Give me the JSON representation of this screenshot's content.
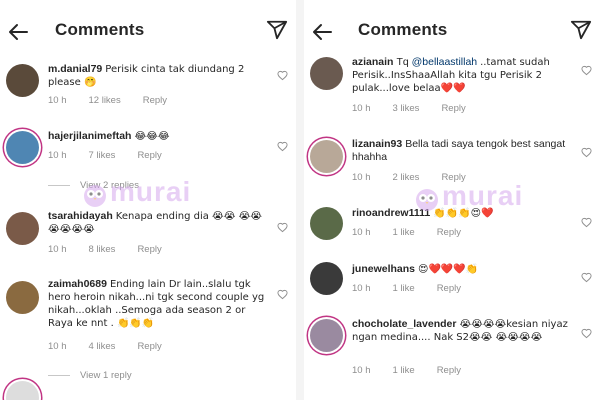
{
  "left": {
    "title": "Comments",
    "comments": [
      {
        "username": "m.danial79",
        "text": "Perisik cinta tak diundang 2 please 🤭",
        "time": "10 h",
        "likes": "12 likes",
        "reply": "Reply",
        "avatar_color": "#5a4a3a"
      },
      {
        "username": "hajerjilanimeftah",
        "text": "😂😂😂",
        "time": "10 h",
        "likes": "7 likes",
        "reply": "Reply",
        "avatar_color": "#4f86b3"
      },
      {
        "username": "tsarahidayah",
        "text": "Kenapa ending dia 😭😭 😭😭😭😭😭😭",
        "time": "10 h",
        "likes": "8 likes",
        "reply": "Reply",
        "avatar_color": "#7a5a48"
      },
      {
        "username": "zaimah0689",
        "text": "Ending lain Dr lain..slalu tgk hero heroin nikah...ni tgk second couple yg nikah...oklah ..Semoga ada season 2 or Raya ke nnt . 👏👏👏",
        "time": "10 h",
        "likes": "4 likes",
        "reply": "Reply",
        "avatar_color": "#8a6a40"
      }
    ],
    "view_replies_1": "View 2 replies",
    "view_replies_2": "View 1 reply"
  },
  "right": {
    "title": "Comments",
    "comments": [
      {
        "username": "azianain",
        "mention": "@bellaastillah",
        "text": "..tamat sudah Perisik..InsShaaAllah kita tgu Perisik  2 pulak...love belaa❤️❤️",
        "prefix": "Tq ",
        "time": "10 h",
        "likes": "3 likes",
        "reply": "Reply",
        "avatar_color": "#6a5a50"
      },
      {
        "username": "lizanain93",
        "text": "Bella tadi saya tengok best sangat hhahha",
        "time": "10 h",
        "likes": "2 likes",
        "reply": "Reply",
        "avatar_color": "#b8a898"
      },
      {
        "username": "rinoandrew1111",
        "text": "👏👏👏😍❤️",
        "time": "10 h",
        "likes": "1 like",
        "reply": "Reply",
        "avatar_color": "#5a6a48"
      },
      {
        "username": "junewelhans",
        "text": "😍❤️❤️❤️👏",
        "time": "10 h",
        "likes": "1 like",
        "reply": "Reply",
        "avatar_color": "#3a3a3a"
      },
      {
        "username": "chocholate_lavender",
        "text": "😭😭😭😭kesian niyaz ngan medina.... Nak S2😭😭 😭😭😭😭",
        "time": "10 h",
        "likes": "1 like",
        "reply": "Reply",
        "avatar_color": "#9a8aa0"
      }
    ]
  },
  "watermark": "murai",
  "colors": {
    "text": "#262626",
    "meta": "#8e8e8e",
    "mention": "#00376b",
    "story_ring": "#c13584",
    "watermark": "#d6a8ee"
  },
  "icons": {
    "back": "arrow-left-icon",
    "send": "paper-plane-icon",
    "like": "heart-outline-icon"
  }
}
